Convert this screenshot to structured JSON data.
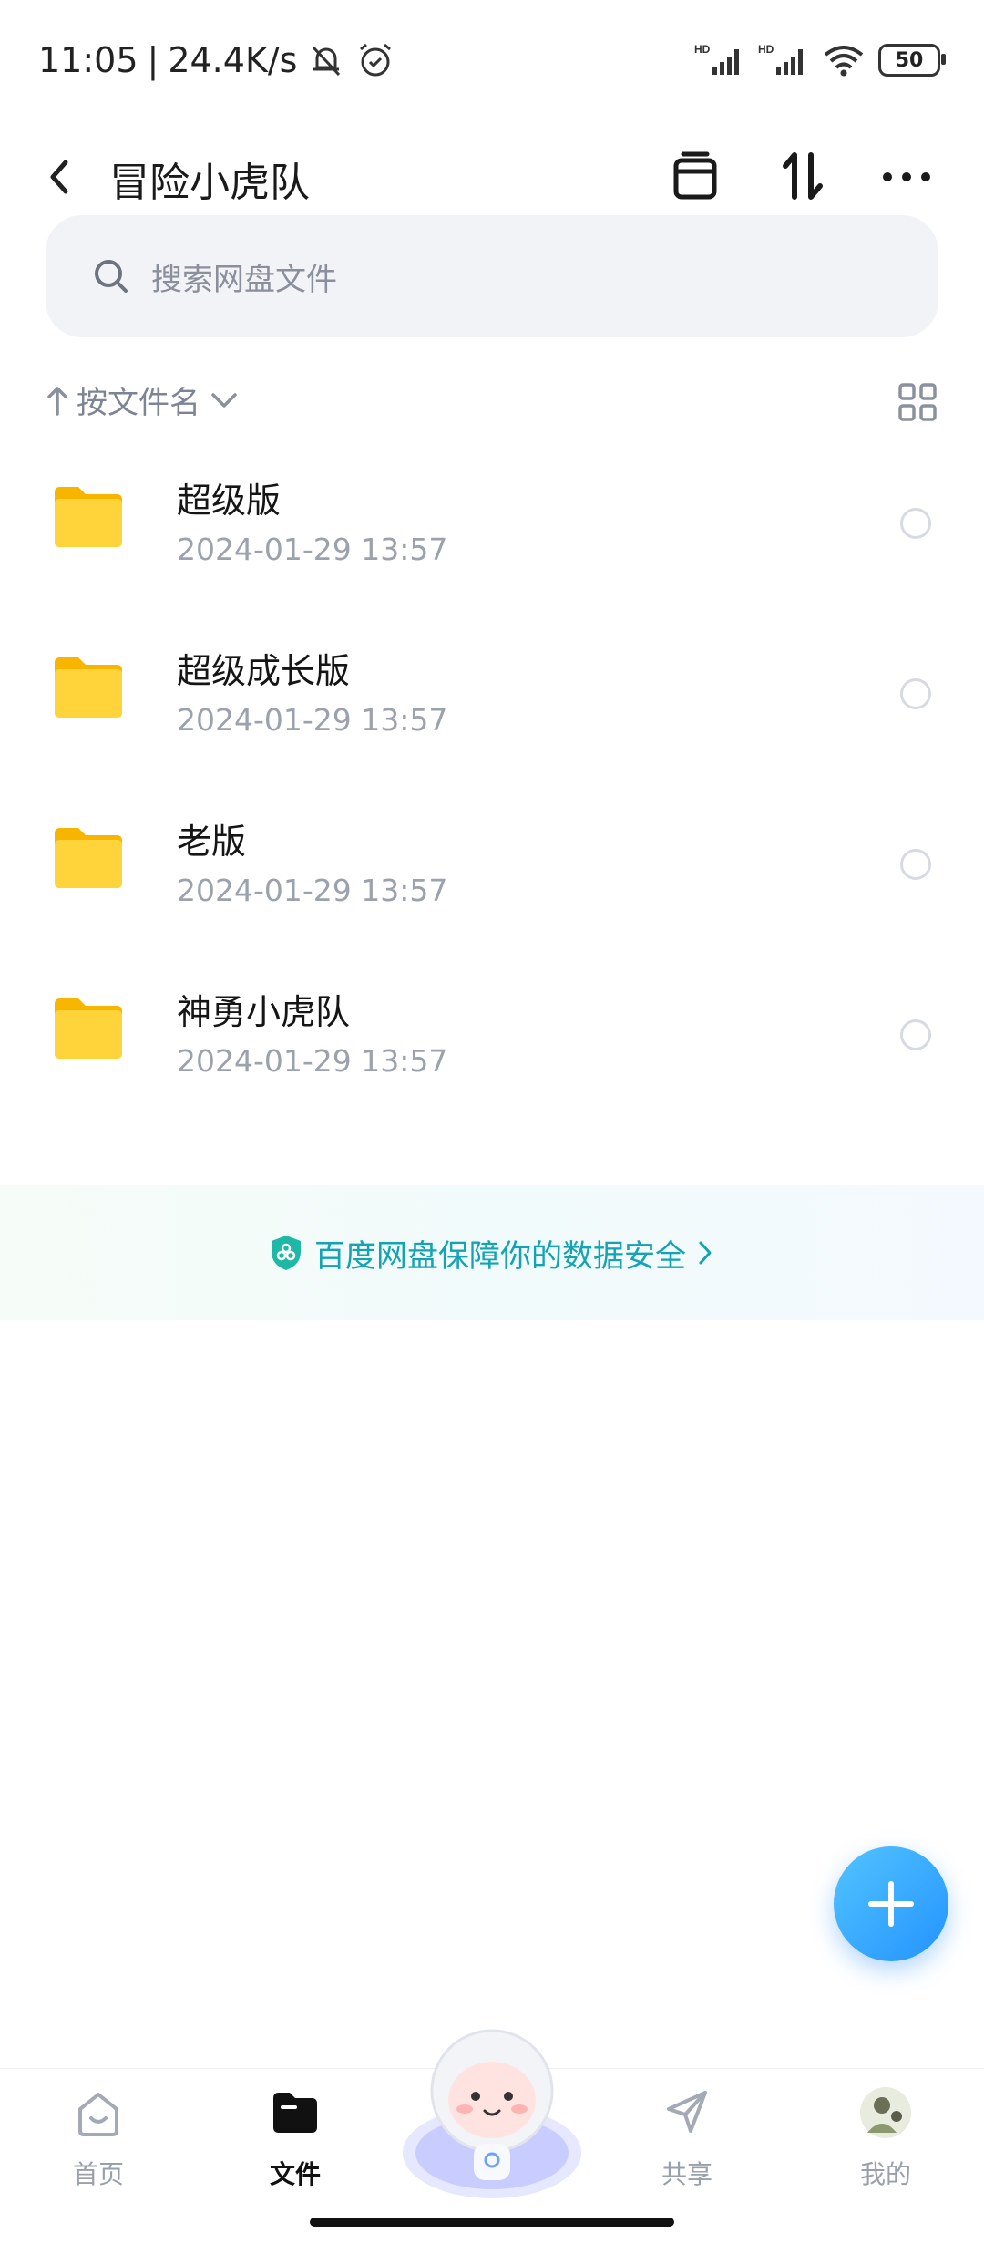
{
  "status_bar": {
    "time": "11:05",
    "speed": "24.4K/s",
    "signal_label_1": "HD",
    "signal_label_2": "HD",
    "battery": "50"
  },
  "header": {
    "title": "冒险小虎队",
    "icons": [
      "back-icon",
      "archive-icon",
      "sort-icon",
      "more-icon"
    ]
  },
  "search": {
    "placeholder": "搜索网盘文件"
  },
  "sort": {
    "label": "按文件名"
  },
  "files": [
    {
      "name": "超级版",
      "date": "2024-01-29  13:57"
    },
    {
      "name": "超级成长版",
      "date": "2024-01-29  13:57"
    },
    {
      "name": "老版",
      "date": "2024-01-29  13:57"
    },
    {
      "name": "神勇小虎队",
      "date": "2024-01-29  13:57"
    }
  ],
  "banner": {
    "text": "百度网盘保障你的数据安全"
  },
  "bottom_nav": {
    "items": [
      {
        "label": "首页",
        "icon": "home-icon"
      },
      {
        "label": "文件",
        "icon": "folder-icon"
      },
      {
        "label": "共享",
        "icon": "share-icon"
      },
      {
        "label": "我的",
        "icon": "avatar-icon"
      }
    ],
    "active": "文件"
  },
  "colors": {
    "accent": "#2493ff",
    "banner_text": "#13a3b3",
    "folder": "#ffc91d"
  }
}
